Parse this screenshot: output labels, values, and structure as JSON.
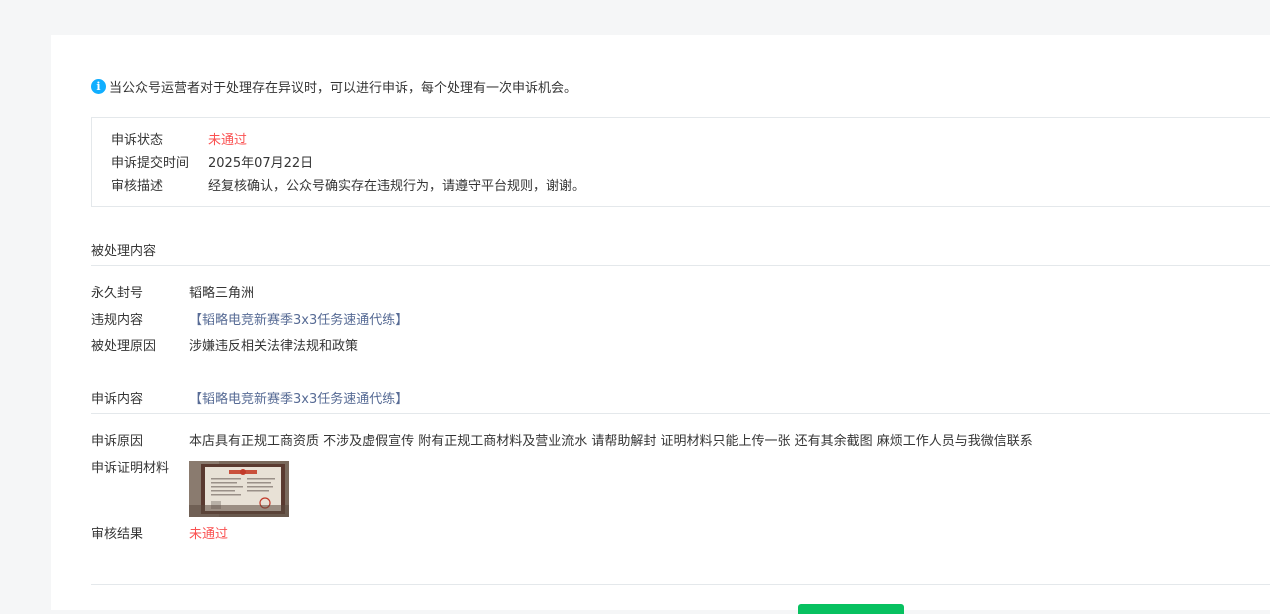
{
  "notice": {
    "text": "当公众号运营者对于处理存在异议时，可以进行申诉，每个处理有一次申诉机会。"
  },
  "status_box": {
    "status_label": "申诉状态",
    "status_value": "未通过",
    "submit_time_label": "申诉提交时间",
    "submit_time_value": "2025年07月22日",
    "review_desc_label": "审核描述",
    "review_desc_value": "经复核确认，公众号确实存在违规行为，请遵守平台规则，谢谢。"
  },
  "handled_content": {
    "title": "被处理内容",
    "ban_label": "永久封号",
    "ban_value": "韬略三角洲",
    "violation_label": "违规内容",
    "violation_value": "【韬略电竞新赛季3x3任务速通代练】",
    "reason_label": "被处理原因",
    "reason_value": "涉嫌违反相关法律法规和政策"
  },
  "appeal": {
    "content_label": "申诉内容",
    "content_value": "【韬略电竞新赛季3x3任务速通代练】",
    "reason_label": "申诉原因",
    "reason_value": "本店具有正规工商资质 不涉及虚假宣传 附有正规工商材料及营业流水 请帮助解封 证明材料只能上传一张 还有其余截图 麻烦工作人员与我微信联系",
    "evidence_label": "申诉证明材料",
    "result_label": "审核结果",
    "result_value": "未通过"
  },
  "colors": {
    "accent_info": "#10aeff",
    "status_red": "#fa5151",
    "link_blue": "#576b95",
    "primary_green": "#07c160"
  }
}
